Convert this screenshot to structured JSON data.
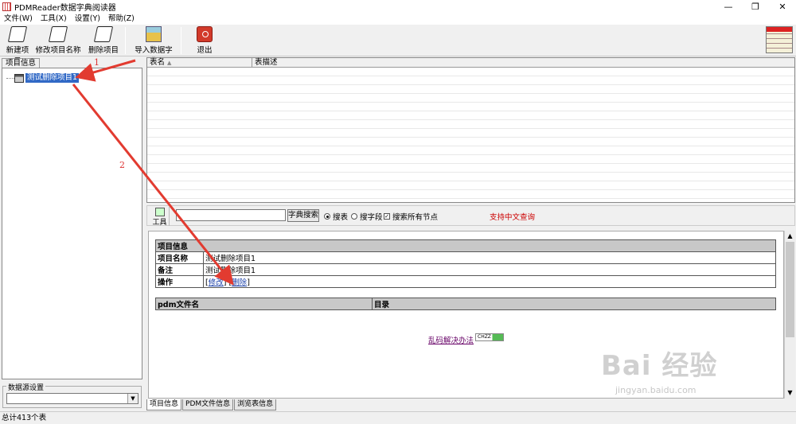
{
  "window": {
    "title": "PDMReader数据字典阅读器"
  },
  "menu": [
    "文件(W)",
    "工具(X)",
    "设置(Y)",
    "帮助(Z)"
  ],
  "toolbar": {
    "new_project": "新建项目",
    "rename_project": "修改项目名称",
    "delete_project": "删除项目",
    "import_dictionary": "导入数据字典",
    "exit": "退出"
  },
  "left_panel": {
    "tab_label": "项目信息",
    "tree_item": "测试删除项目1",
    "datasource_label": "数据源设置",
    "datasource_value": ""
  },
  "grid": {
    "col_name": "表名",
    "col_desc": "表描述"
  },
  "search": {
    "tools_label": "工具",
    "input_value": "",
    "button": "字典搜索",
    "opt_table": "搜表",
    "opt_field": "搜字段",
    "opt_all_nodes": "搜索所有节点",
    "chinese_note": "支持中文查询"
  },
  "detail": {
    "header": "项目信息",
    "name_label": "项目名称",
    "name_value": "测试删除项目1",
    "remark_label": "备注",
    "remark_value": "测试删除项目1",
    "action_label": "操作",
    "edit_link": "修改",
    "delete_link": "删除",
    "pdm_col": "pdm文件名",
    "dir_col": "目录",
    "garbled_link": "乱码解决办法",
    "badge_text": "CHZZ"
  },
  "bottom_tabs": [
    "项目信息",
    "PDM文件信息",
    "浏览表信息"
  ],
  "status": {
    "text": "总计413个表"
  },
  "annotations": {
    "one": "1",
    "two": "2"
  },
  "watermark": {
    "logo": "Bai 经验",
    "sub": "jingyan.baidu.com"
  },
  "colors": {
    "selection": "#3169c6",
    "annotation": "#d33",
    "note": "#c00"
  }
}
